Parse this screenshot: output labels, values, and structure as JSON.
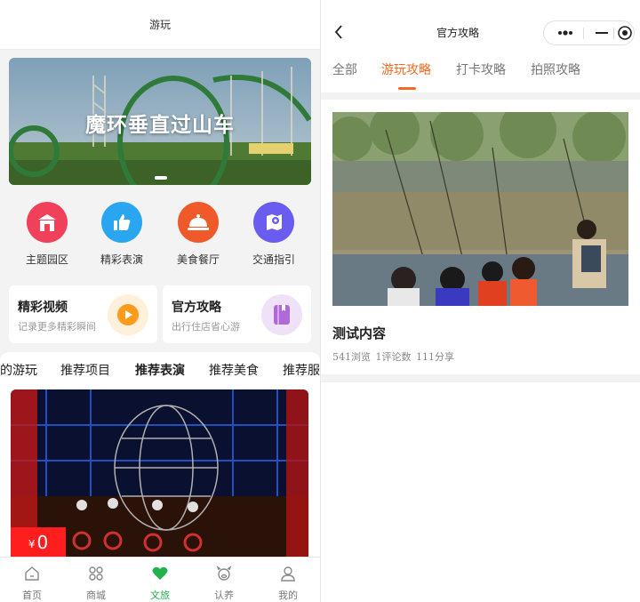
{
  "left": {
    "header_title": "游玩",
    "banner": {
      "title": "魔环垂直过山车"
    },
    "categories": [
      {
        "label": "主题园区",
        "icon": "castle-icon",
        "color": "#f0405a"
      },
      {
        "label": "精彩表演",
        "icon": "thumbs-up-icon",
        "color": "#2aa6f0"
      },
      {
        "label": "美食餐厅",
        "icon": "food-cloche-icon",
        "color": "#f05a2a"
      },
      {
        "label": "交通指引",
        "icon": "map-pin-icon",
        "color": "#6a5cf0"
      }
    ],
    "cards": [
      {
        "title": "精彩视频",
        "subtitle": "记录更多精彩瞬间",
        "icon": "play-icon",
        "color": "#ff9a1a"
      },
      {
        "title": "官方攻略",
        "subtitle": "出行住店省心游",
        "icon": "book-icon",
        "color": "#b06ad8"
      }
    ],
    "rec_tabs": [
      "的游玩",
      "推荐项目",
      "推荐表演",
      "推荐美食",
      "推荐服"
    ],
    "active_rec_tab": "推荐表演",
    "show": {
      "price_currency": "¥",
      "price_value": "0"
    },
    "tabbar": [
      {
        "label": "首页",
        "icon": "home-icon"
      },
      {
        "label": "商城",
        "icon": "grid-icon"
      },
      {
        "label": "文旅",
        "icon": "heart-icon"
      },
      {
        "label": "认养",
        "icon": "pig-icon"
      },
      {
        "label": "我的",
        "icon": "user-icon"
      }
    ],
    "active_tab": "文旅"
  },
  "right": {
    "header_title": "官方攻略",
    "tabs": [
      "全部",
      "游玩攻略",
      "打卡攻略",
      "拍照攻略"
    ],
    "active_tab": "游玩攻略",
    "post": {
      "title": "测试内容",
      "views": "541浏览",
      "comments": "1评论数",
      "shares": "111分享"
    }
  },
  "colors": {
    "accent_orange": "#f36b22",
    "accent_green": "#22b14c",
    "price_red": "#ff1e1e"
  }
}
